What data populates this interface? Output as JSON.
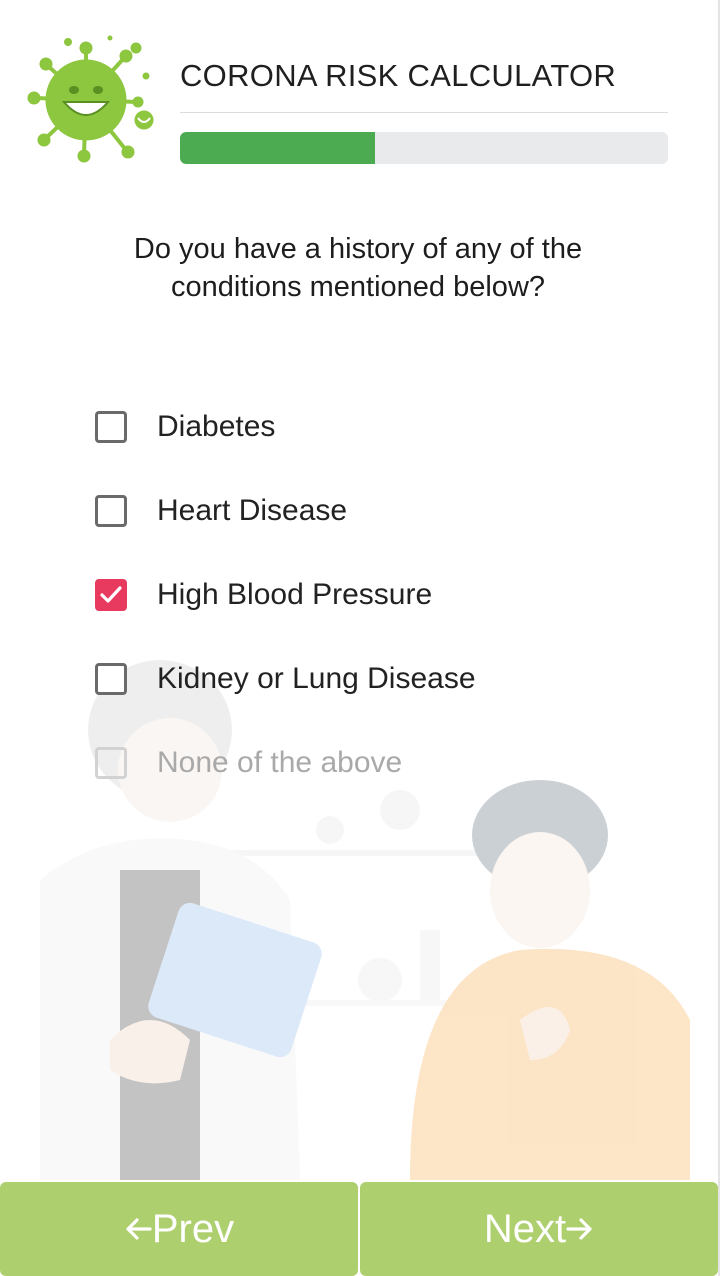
{
  "header": {
    "title": "CORONA RISK CALCULATOR",
    "progress_fraction": 0.4
  },
  "question": {
    "line1": "Do you have a history of any of the",
    "line2": "conditions mentioned below?"
  },
  "options": [
    {
      "label": "Diabetes",
      "checked": false,
      "disabled": false
    },
    {
      "label": "Heart Disease",
      "checked": false,
      "disabled": false
    },
    {
      "label": "High Blood Pressure",
      "checked": true,
      "disabled": false
    },
    {
      "label": "Kidney or Lung Disease",
      "checked": false,
      "disabled": false
    },
    {
      "label": "None of the above",
      "checked": false,
      "disabled": true
    }
  ],
  "footer": {
    "prev_label": "Prev",
    "next_label": "Next"
  },
  "colors": {
    "progress": "#4caa50",
    "checked": "#e83a5f",
    "button": "#aecf6e",
    "virus": "#8dc63f"
  },
  "icons": {
    "logo": "virus-mascot-icon",
    "prev": "arrow-left-icon",
    "next": "arrow-right-icon",
    "check": "checkmark-icon"
  }
}
